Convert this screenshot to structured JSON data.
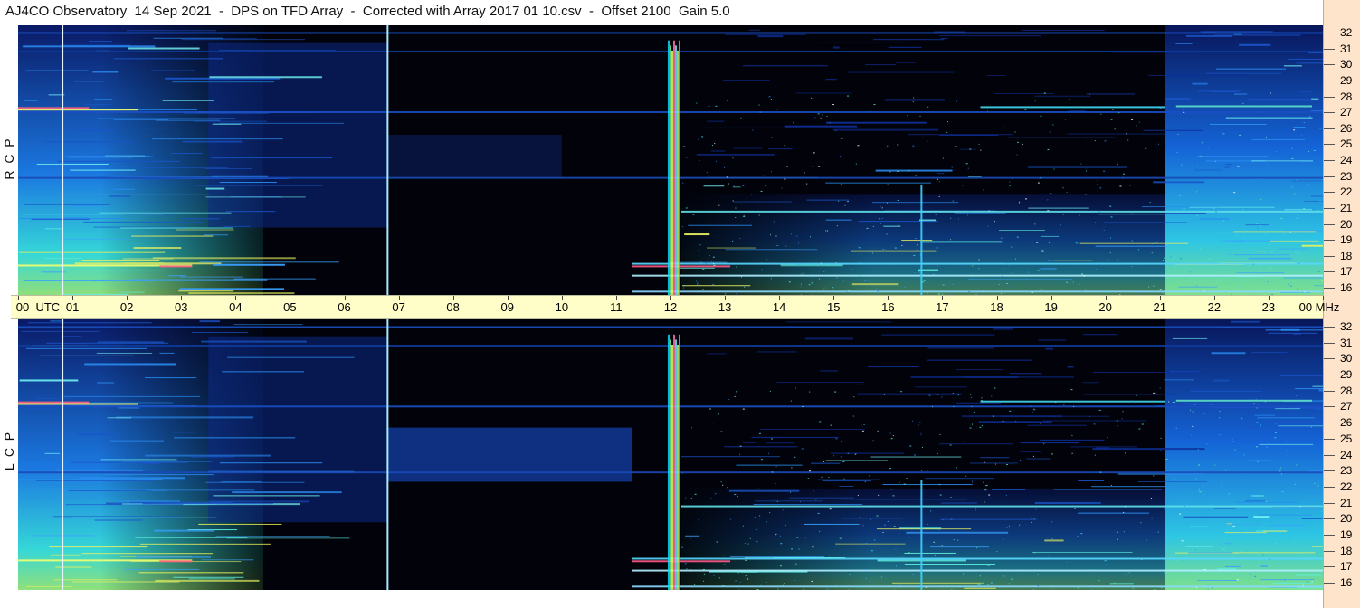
{
  "title": "AJ4CO Observatory  14 Sep 2021  -  DPS on TFD Array  -  Corrected with Array 2017 01 10.csv  -  Offset 2100  Gain 5.0",
  "panels": {
    "top_label": "R  C  P",
    "bottom_label": "L  C  P"
  },
  "time_axis": {
    "labels": [
      "00",
      "01",
      "02",
      "03",
      "04",
      "05",
      "06",
      "07",
      "08",
      "09",
      "10",
      "11",
      "12",
      "13",
      "14",
      "15",
      "16",
      "17",
      "18",
      "19",
      "20",
      "21",
      "22",
      "23",
      "00"
    ],
    "start_unit": "UTC",
    "end_unit": "MHz"
  },
  "freq_axis": {
    "labels": [
      "32",
      "31",
      "30",
      "29",
      "28",
      "27",
      "26",
      "25",
      "24",
      "23",
      "22",
      "21",
      "20",
      "19",
      "18",
      "17",
      "16"
    ]
  },
  "colors": {
    "background": "#02030a",
    "time_axis_bg": "#fffdc8",
    "freq_axis_bg": "#ffe4cc"
  },
  "chart_data": {
    "type": "heatmap",
    "title": "AJ4CO Observatory  14 Sep 2021  -  DPS on TFD Array  -  Corrected with Array 2017 01 10.csv  -  Offset 2100  Gain 5.0",
    "x_label": "UTC",
    "y_label": "MHz",
    "x_range_hours": [
      0,
      24
    ],
    "y_range_mhz": [
      16,
      32
    ],
    "panels": [
      "R C P",
      "L C P"
    ],
    "features": {
      "vertical_lines_utc": [
        0.8,
        6.78
      ],
      "burst_utc": [
        11.9,
        12.1
      ],
      "spike_utc": 16.6,
      "bright_bands_mhz": [
        27.1,
        17.8,
        17.2,
        21.0
      ]
    }
  }
}
